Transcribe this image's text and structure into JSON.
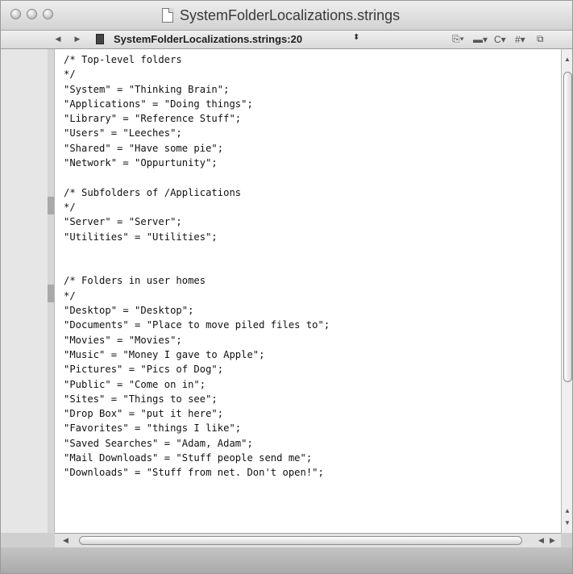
{
  "window": {
    "title": "SystemFolderLocalizations.strings"
  },
  "navbar": {
    "back_glyph": "◀",
    "forward_glyph": "▶",
    "jump_label": "SystemFolderLocalizations.strings:20",
    "jump_arrows": "⬍",
    "tools": [
      {
        "name": "bookmarks-tool",
        "glyph": "⎘▾"
      },
      {
        "name": "navigation-tool",
        "glyph": "▬▾"
      },
      {
        "name": "class-tool",
        "glyph": "C▾"
      },
      {
        "name": "includes-tool",
        "glyph": "#▾"
      },
      {
        "name": "counterparts-tool",
        "glyph": "⧉"
      }
    ]
  },
  "editor": {
    "lines": [
      "/* Top-level folders",
      "*/",
      "\"System\" = \"Thinking Brain\";",
      "\"Applications\" = \"Doing things\";",
      "\"Library\" = \"Reference Stuff\";",
      "\"Users\" = \"Leeches\";",
      "\"Shared\" = \"Have some pie\";",
      "\"Network\" = \"Oppurtunity\";",
      "",
      "/* Subfolders of /Applications",
      "*/",
      "\"Server\" = \"Server\";",
      "\"Utilities\" = \"Utilities\";",
      "",
      "",
      "/* Folders in user homes",
      "*/",
      "\"Desktop\" = \"Desktop\";",
      "\"Documents\" = \"Place to move piled files to\";",
      "\"Movies\" = \"Movies\";",
      "\"Music\" = \"Money I gave to Apple\";",
      "\"Pictures\" = \"Pics of Dog\";",
      "\"Public\" = \"Come on in\";",
      "\"Sites\" = \"Things to see\";",
      "\"Drop Box\" = \"put it here\";",
      "\"Favorites\" = \"things I like\";",
      "\"Saved Searches\" = \"Adam, Adam\";",
      "\"Mail Downloads\" = \"Stuff people send me\";",
      "\"Downloads\" = \"Stuff from net. Don't open!\";"
    ]
  },
  "scrollbars": {
    "up_glyph": "▲",
    "down_glyph": "▼",
    "left_glyph": "◀",
    "right_glyph": "▶"
  }
}
